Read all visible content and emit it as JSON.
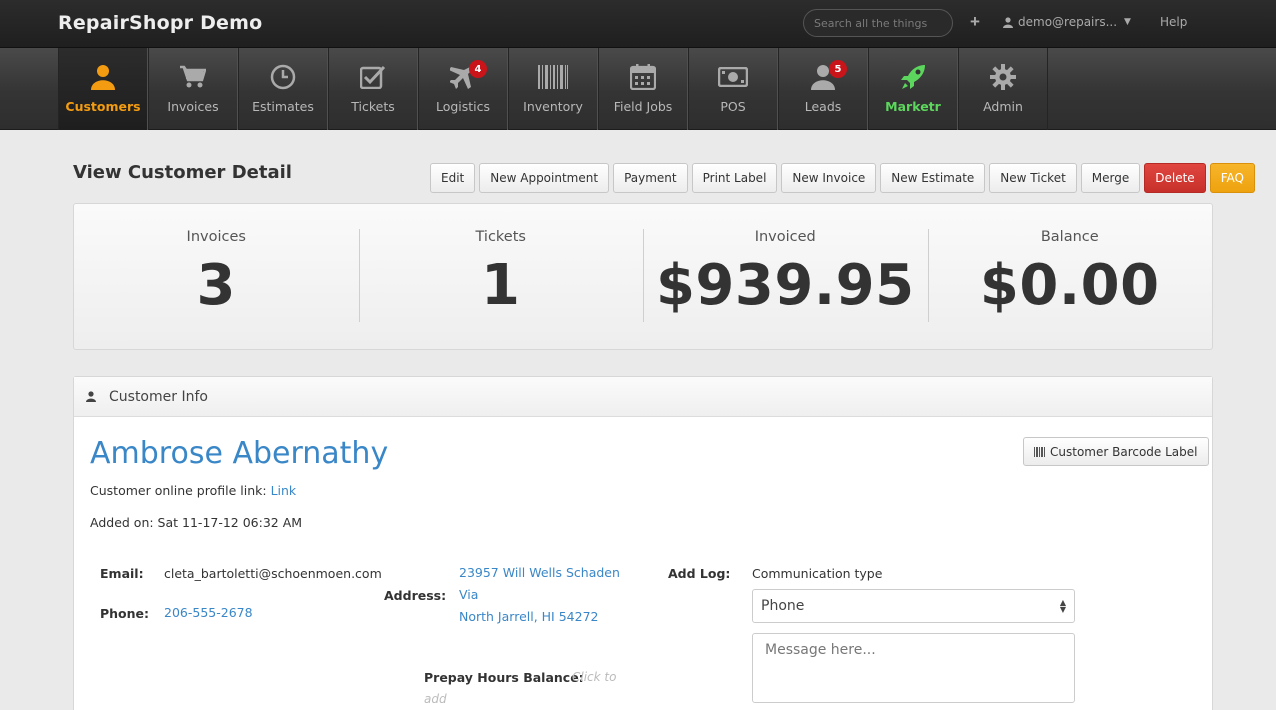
{
  "topbar": {
    "brand": "RepairShopr Demo",
    "search_placeholder": "Search all the things",
    "plus": "+",
    "user": "demo@repairs...",
    "help": "Help"
  },
  "nav": [
    {
      "label": "Customers",
      "icon": "user-icon",
      "active": true
    },
    {
      "label": "Invoices",
      "icon": "cart-icon"
    },
    {
      "label": "Estimates",
      "icon": "clock-icon"
    },
    {
      "label": "Tickets",
      "icon": "checkbox-icon"
    },
    {
      "label": "Logistics",
      "icon": "plane-icon",
      "badge": "4"
    },
    {
      "label": "Inventory",
      "icon": "barcode-icon"
    },
    {
      "label": "Field Jobs",
      "icon": "calendar-icon"
    },
    {
      "label": "POS",
      "icon": "money-icon"
    },
    {
      "label": "Leads",
      "icon": "user-icon",
      "badge": "5"
    },
    {
      "label": "Marketr",
      "icon": "rocket-icon"
    },
    {
      "label": "Admin",
      "icon": "gear-icon"
    }
  ],
  "page": {
    "title": "View Customer Detail"
  },
  "actions": {
    "edit": "Edit",
    "new_appointment": "New Appointment",
    "payment": "Payment",
    "print_label": "Print Label",
    "new_invoice": "New Invoice",
    "new_estimate": "New Estimate",
    "new_ticket": "New Ticket",
    "merge": "Merge",
    "delete": "Delete",
    "faq": "FAQ"
  },
  "stats": {
    "invoices_label": "Invoices",
    "invoices_value": "3",
    "tickets_label": "Tickets",
    "tickets_value": "1",
    "invoiced_label": "Invoiced",
    "invoiced_value": "$939.95",
    "balance_label": "Balance",
    "balance_value": "$0.00"
  },
  "customer": {
    "panel_title": "Customer Info",
    "name": "Ambrose Abernathy",
    "barcode_label": "Customer Barcode Label",
    "profile_link_label": "Customer online profile link:",
    "profile_link_text": "Link",
    "added_on": "Added on: Sat 11-17-12 06:32 AM",
    "email_label": "Email:",
    "email": "cleta_bartoletti@schoenmoen.com",
    "phone_label": "Phone:",
    "phone": "206-555-2678",
    "address_label": "Address:",
    "address_line1": "23957 Will Wells Schaden",
    "address_line2": "Via",
    "address_line3": "North Jarrell, HI 54272",
    "prepay_label": "Prepay Hours Balance:",
    "prepay_click": "Click to",
    "prepay_add": "add",
    "add_log_label": "Add Log:",
    "comm_type_label": "Communication type",
    "comm_type_value": "Phone",
    "message_placeholder": "Message here..."
  },
  "colors": {
    "accent_orange": "#f39c12",
    "link_blue": "#3a87c8",
    "marketr_green": "#5cd65c",
    "badge_red": "#c9141a",
    "delete_red": "#d9534f",
    "faq_orange": "#f0ad4e"
  }
}
